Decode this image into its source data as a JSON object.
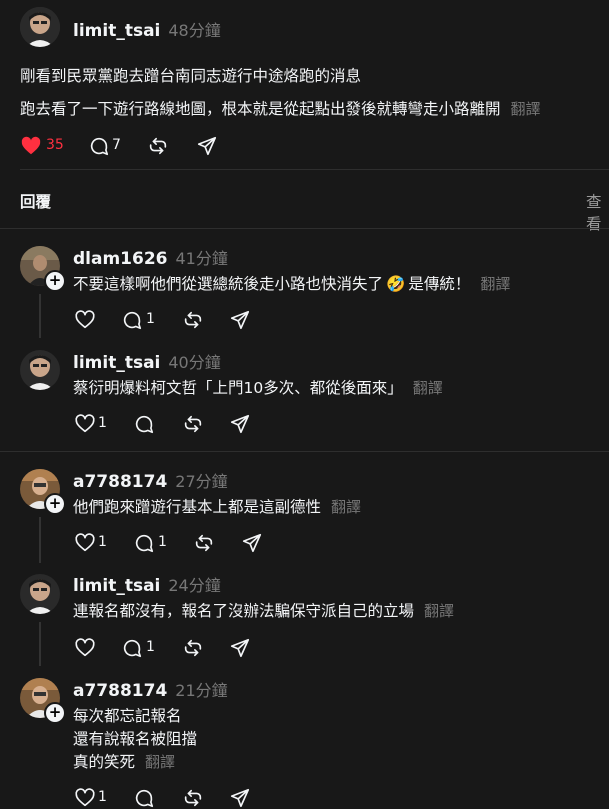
{
  "post": {
    "username": "limit_tsai",
    "time": "48分鐘",
    "line1": "剛看到民眾黨跑去蹭台南同志遊行中途烙跑的消息",
    "line2": "跑去看了一下遊行路線地圖，根本就是從起點出發後就轉彎走小路離開",
    "translate": "翻譯",
    "likes": "35",
    "replies": "7"
  },
  "tabs": {
    "replies_label": "回覆",
    "view_label": "查看"
  },
  "comments": [
    {
      "username": "dlam1626",
      "time": "41分鐘",
      "text": "不要這樣啊他們從選總統後走小路也快消失了",
      "emoji": "🤣",
      "text_after": "是傳統！",
      "translate": "翻譯",
      "likes": "",
      "replies": "1"
    },
    {
      "username": "limit_tsai",
      "time": "40分鐘",
      "text": "蔡衍明爆料柯文哲「上門10多次、都從後面來」",
      "translate": "翻譯",
      "likes": "1",
      "replies": ""
    },
    {
      "username": "a7788174",
      "time": "27分鐘",
      "text": "他們跑來蹭遊行基本上都是這副德性",
      "translate": "翻譯",
      "likes": "1",
      "replies": "1"
    },
    {
      "username": "limit_tsai",
      "time": "24分鐘",
      "text": "連報名都沒有，報名了沒辦法騙保守派自己的立場",
      "translate": "翻譯",
      "likes": "",
      "replies": "1"
    },
    {
      "username": "a7788174",
      "time": "21分鐘",
      "line1": "每次都忘記報名",
      "line2": "還有說報名被阻擋",
      "line3": "真的笑死",
      "translate": "翻譯",
      "likes": "1",
      "replies": ""
    }
  ],
  "colors": {
    "background": "#181818",
    "like_red": "#ff3040",
    "muted": "#777777"
  },
  "icons": [
    "heart-icon",
    "comment-icon",
    "repost-icon",
    "share-icon",
    "plus-icon"
  ]
}
